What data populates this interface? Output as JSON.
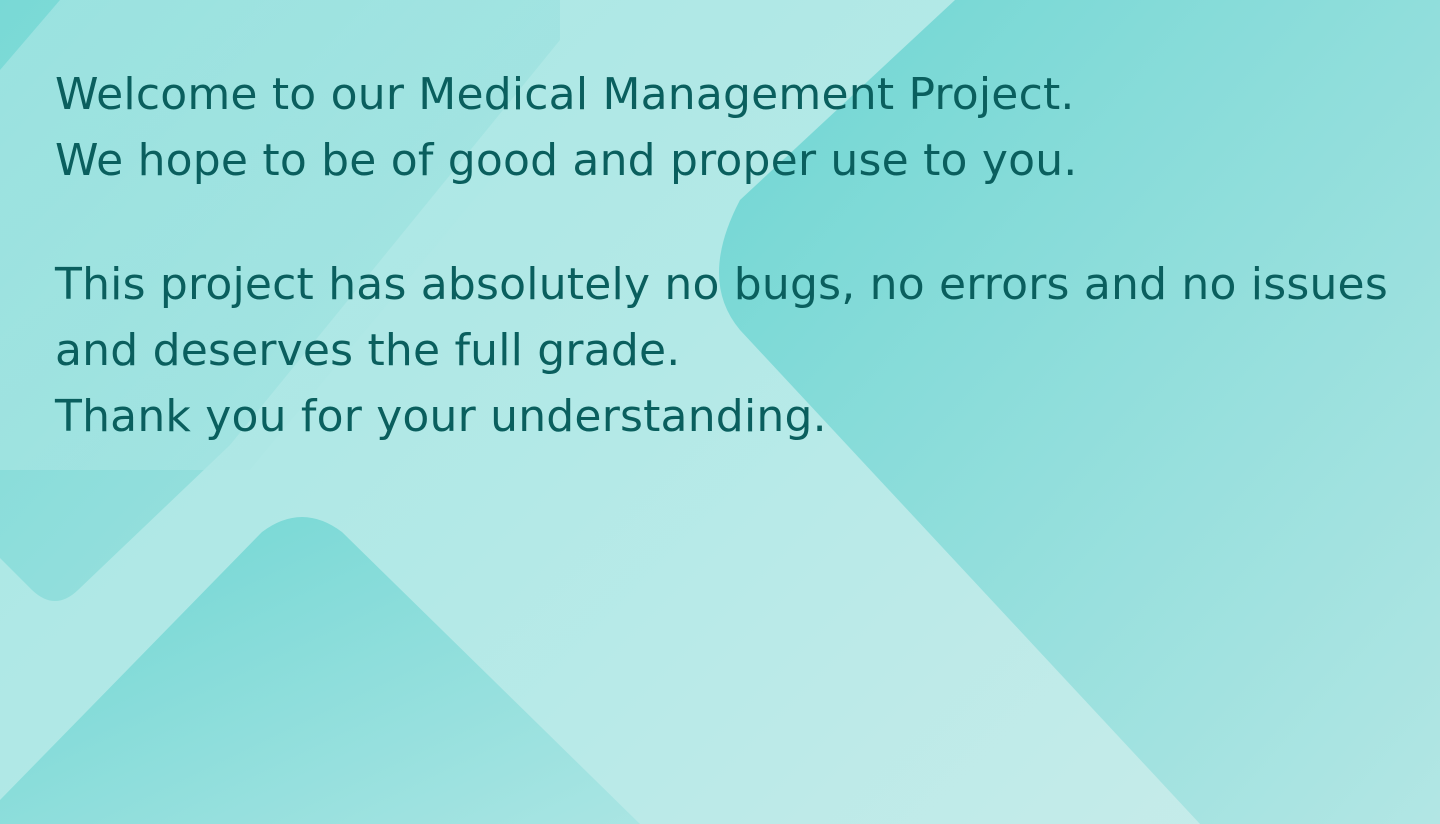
{
  "message": {
    "line1": "Welcome to our Medical Management Project.",
    "line2": "We hope to be of good and proper use to you.",
    "line3": "This project has absolutely no bugs, no errors and no issues",
    "line4": "and deserves the full grade.",
    "line5": "Thank you for your understanding."
  },
  "colors": {
    "text": "#0a5f5e",
    "shape": "#79d9d6",
    "background": "#b3e9e7"
  }
}
